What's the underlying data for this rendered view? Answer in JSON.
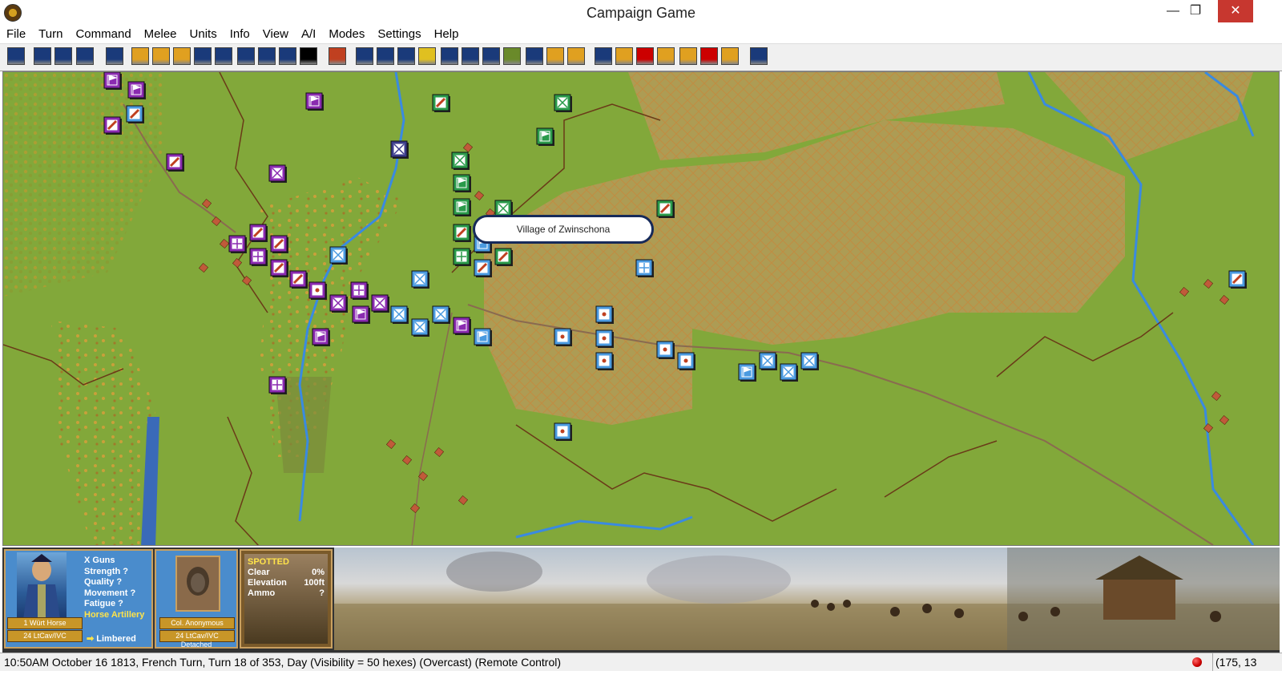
{
  "window": {
    "title": "Campaign Game",
    "minimize": "—",
    "maximize": "❐",
    "close": "✕"
  },
  "menu": [
    "File",
    "Turn",
    "Command",
    "Melee",
    "Units",
    "Info",
    "View",
    "A/I",
    "Modes",
    "Settings",
    "Help"
  ],
  "map": {
    "tooltip": "Village of Zwinschona"
  },
  "unit_panel": {
    "lines": [
      "X Guns",
      "Strength ?",
      "Quality ?",
      "Movement ?",
      "Fatigue ?"
    ],
    "type": "Horse Artillery",
    "unit_name": "1 Würt Horse",
    "unit_formation": "24 LtCav/IVC",
    "status": "Limbered"
  },
  "leader_panel": {
    "name": "Col. Anonymous",
    "formation": "24 LtCav/IVC",
    "status": "Detached"
  },
  "terrain_panel": {
    "header": "SPOTTED",
    "rows": [
      {
        "label": "Clear",
        "value": "0%"
      },
      {
        "label": "Elevation",
        "value": "100ft"
      },
      {
        "label": "Ammo",
        "value": "?"
      }
    ]
  },
  "status": {
    "text": "10:50AM October 16 1813, French Turn, Turn 18 of 353, Day (Visibility = 50 hexes) (Overcast) (Remote Control)",
    "coords": "(175, 13"
  },
  "colors": {
    "map_green": "#82a83a",
    "map_orange": "#c8a060",
    "french_purple": "#8a2ab0",
    "allied_blue": "#3a8ae0",
    "allied_green": "#2a9a4a"
  }
}
